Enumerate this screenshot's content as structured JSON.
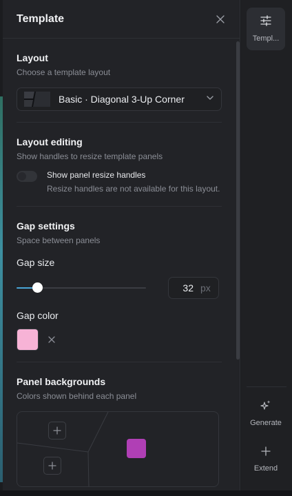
{
  "panel": {
    "title": "Template",
    "close_icon": "close-icon"
  },
  "layout_section": {
    "title": "Layout",
    "description": "Choose a template layout",
    "selected_layout": "Basic · Diagonal 3-Up Corner",
    "dropdown_icon": "chevron-down-icon"
  },
  "layout_editing": {
    "title": "Layout editing",
    "description": "Show handles to resize template panels",
    "toggle_label": "Show panel resize handles",
    "toggle_on": false,
    "note": "Resize handles are not available for this layout."
  },
  "gap_settings": {
    "title": "Gap settings",
    "description": "Space between panels",
    "gap_size_label": "Gap size",
    "gap_value": "32",
    "gap_unit": "px",
    "slider_fraction": 0.16,
    "gap_color_label": "Gap color",
    "gap_color": "#f7b3d6",
    "clear_icon": "close-icon"
  },
  "panel_backgrounds": {
    "title": "Panel backgrounds",
    "description": "Colors shown behind each panel",
    "panel_color": "#b03fb5"
  },
  "rail": {
    "template_label": "Templ...",
    "template_icon": "sliders-icon",
    "generate_label": "Generate",
    "generate_icon": "sparkles-icon",
    "extend_label": "Extend",
    "extend_icon": "plus-icon"
  },
  "colors": {
    "accent": "#49a6d8",
    "panel_bg": "#222327",
    "rail_bg": "#1f2023"
  }
}
